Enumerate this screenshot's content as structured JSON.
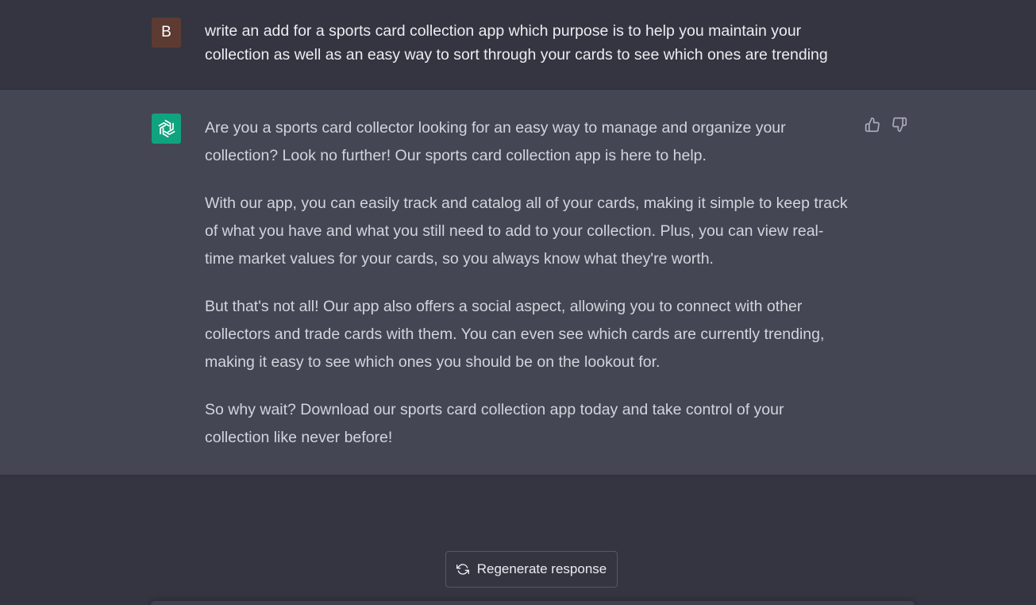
{
  "conversation": {
    "user_message": {
      "avatar_letter": "B",
      "text": "write an add for a sports card collection app which purpose is to help you maintain your collection as well as an easy way to sort through your cards to see which ones are trending"
    },
    "assistant_message": {
      "paragraphs": [
        "Are you a sports card collector looking for an easy way to manage and organize your collection? Look no further! Our sports card collection app is here to help.",
        "With our app, you can easily track and catalog all of your cards, making it simple to keep track of what you have and what you still need to add to your collection. Plus, you can view real-time market values for your cards, so you always know what they're worth.",
        "But that's not all! Our app also offers a social aspect, allowing you to connect with other collectors and trade cards with them. You can even see which cards are currently trending, making it easy to see which ones you should be on the lookout for.",
        "So why wait? Download our sports card collection app today and take control of your collection like never before!"
      ]
    }
  },
  "actions": {
    "regenerate_label": "Regenerate response"
  },
  "icons": {
    "bot_avatar": "openai-logo-icon",
    "thumbs_up": "thumbs-up-icon",
    "thumbs_down": "thumbs-down-icon",
    "regenerate": "refresh-icon"
  },
  "colors": {
    "background": "#343541",
    "assistant_background": "#444654",
    "user_avatar": "#5d3b32",
    "bot_avatar": "#10a37f"
  }
}
